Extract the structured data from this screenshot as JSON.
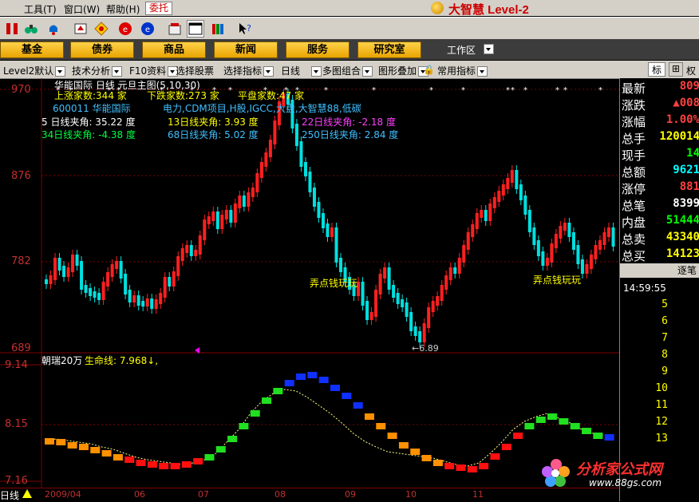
{
  "menu": {
    "items": [
      "工具(T)",
      "窗口(W)",
      "帮助(H)"
    ],
    "partial": "",
    "weituo": "委托",
    "brand": "大智慧 Level-2"
  },
  "nav": {
    "buttons": [
      "基金",
      "债券",
      "商品",
      "新闻",
      "服务",
      "研究室"
    ],
    "workzone": "工作区"
  },
  "func": {
    "items": [
      "Level2默认",
      "技术分析",
      "F10资料",
      "选择股票",
      "选择指标",
      "日线",
      "多图组合",
      "图形叠加",
      "常用指标"
    ],
    "right": [
      "标",
      "⊞",
      "权"
    ]
  },
  "main": {
    "title": "华能国际 日线  元旦主图(5,10,30)",
    "up_count": "上涨家数:344 家",
    "down_count": "下跌家数:273 家",
    "flat_count": "平盘家数:47 家",
    "stock_code": "600011 华能国际",
    "tags": "电力,CDM项目,H股,IGCC,大盘,大智慧88,低碳",
    "angles": [
      {
        "label": "5 日线夹角: 35.22 度",
        "color": "#ffffff"
      },
      {
        "label": "13日线夹角: 3.93 度",
        "color": "#ffff00"
      },
      {
        "label": "22日线夹角: -2.18 度",
        "color": "#ff40ff"
      },
      {
        "label": "34日线夹角: -4.38 度",
        "color": "#00ff40"
      },
      {
        "label": "68日线夹角: 5.02 度",
        "color": "#40c0ff"
      },
      {
        "label": "250日线夹角: 2.84 度",
        "color": "#40c0ff"
      }
    ],
    "price_axis": [
      "970",
      "876",
      "782",
      "689"
    ],
    "annotations": [
      "弄点钱玩玩",
      "弄点钱玩玩"
    ],
    "low_label": "6.89"
  },
  "sub": {
    "title": "朝瑞20万",
    "life_line": "生命线: 7.968↓,",
    "axis": [
      "9.14",
      "8.15",
      "7.16"
    ]
  },
  "bottom": {
    "period": "日线",
    "months": [
      "2009/04",
      "06",
      "07",
      "08",
      "09",
      "10",
      "11"
    ]
  },
  "right_panel": {
    "rows": [
      {
        "label": "最新",
        "value": "809",
        "color": "#ff4040"
      },
      {
        "label": "涨跌",
        "value": "▲008",
        "color": "#ff4040"
      },
      {
        "label": "涨幅",
        "value": "1.00%",
        "color": "#ff4040"
      },
      {
        "label": "总手",
        "value": "120014",
        "color": "#ffff00"
      },
      {
        "label": "现手",
        "value": "14",
        "color": "#00ff00"
      },
      {
        "label": "总额",
        "value": "9621",
        "color": "#00ffff"
      },
      {
        "label": "涨停",
        "value": "881",
        "color": "#ff4040"
      },
      {
        "label": "总笔",
        "value": "8399",
        "color": "#ffffff"
      },
      {
        "label": "内盘",
        "value": "51444",
        "color": "#00ff00"
      },
      {
        "label": "总卖",
        "value": "43340",
        "color": "#ffff00"
      },
      {
        "label": "总买",
        "value": "14123",
        "color": "#ffff00"
      }
    ],
    "link": "逐笔",
    "time": "14:59:55",
    "ticks": [
      "5",
      "6",
      "7",
      "8",
      "9",
      "10",
      "11",
      "12",
      "13"
    ]
  },
  "watermark": {
    "text": "分析家公式网",
    "url": "www.88gs.com"
  },
  "chart_data": {
    "type": "candlestick",
    "price_axis_labels": [
      "970",
      "876",
      "782",
      "689"
    ],
    "sub_axis_labels": [
      "9.14",
      "8.15",
      "7.16"
    ],
    "low_marker": 6.89,
    "x_labels": [
      "2009/04",
      "06",
      "07",
      "08",
      "09",
      "10",
      "11"
    ]
  }
}
